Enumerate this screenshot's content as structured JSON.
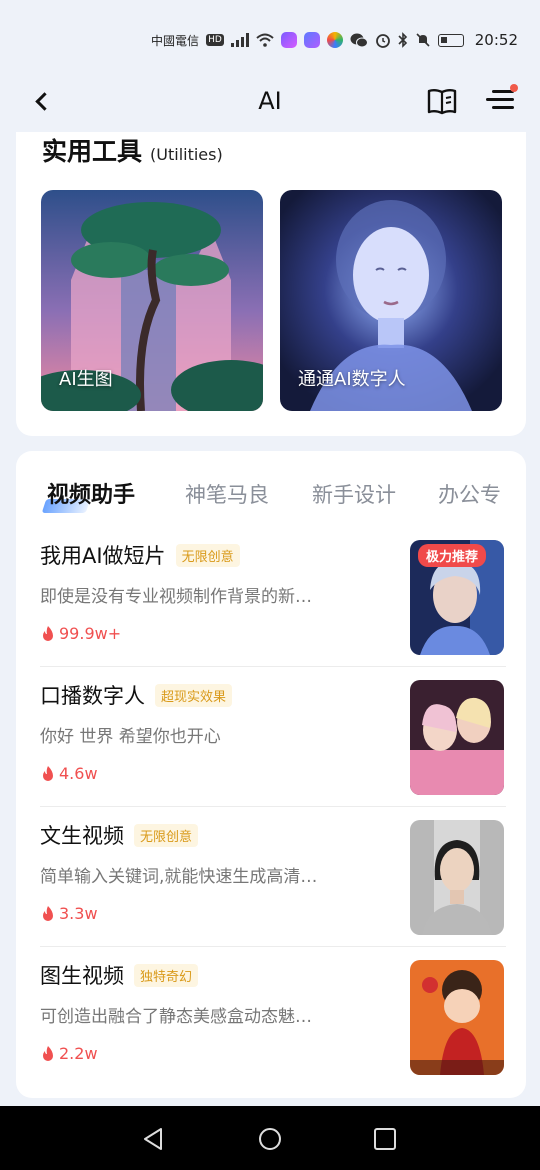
{
  "status_bar": {
    "carrier": "中國電信",
    "hd": "HD",
    "time": "20:52"
  },
  "header": {
    "title": "AI"
  },
  "utilities": {
    "title": "实用工具",
    "subtitle": "(Utilities)",
    "tiles": [
      {
        "label": "AI生图"
      },
      {
        "label": "通通AI数字人"
      }
    ]
  },
  "tabs": [
    {
      "label": "视频助手",
      "active": true
    },
    {
      "label": "神笔马良"
    },
    {
      "label": "新手设计"
    },
    {
      "label": "办公专"
    }
  ],
  "items": [
    {
      "title": "我用AI做短片",
      "badge": "无限创意",
      "desc": "即使是没有专业视频制作背景的新…",
      "stat": "99.9w+",
      "thumb_tag": "极力推荐"
    },
    {
      "title": "口播数字人",
      "badge": "超现实效果",
      "desc": "你好 世界 希望你也开心",
      "stat": "4.6w"
    },
    {
      "title": "文生视频",
      "badge": "无限创意",
      "desc": "简单输入关键词,就能快速生成高清…",
      "stat": "3.3w"
    },
    {
      "title": "图生视频",
      "badge": "独特奇幻",
      "desc": "可创造出融合了静态美感盒动态魅…",
      "stat": "2.2w"
    }
  ],
  "colors": {
    "accent_red": "#f05050",
    "badge_text": "#d99a1a",
    "badge_bg": "#fdf5e1",
    "page_bg": "#eef2f9"
  }
}
